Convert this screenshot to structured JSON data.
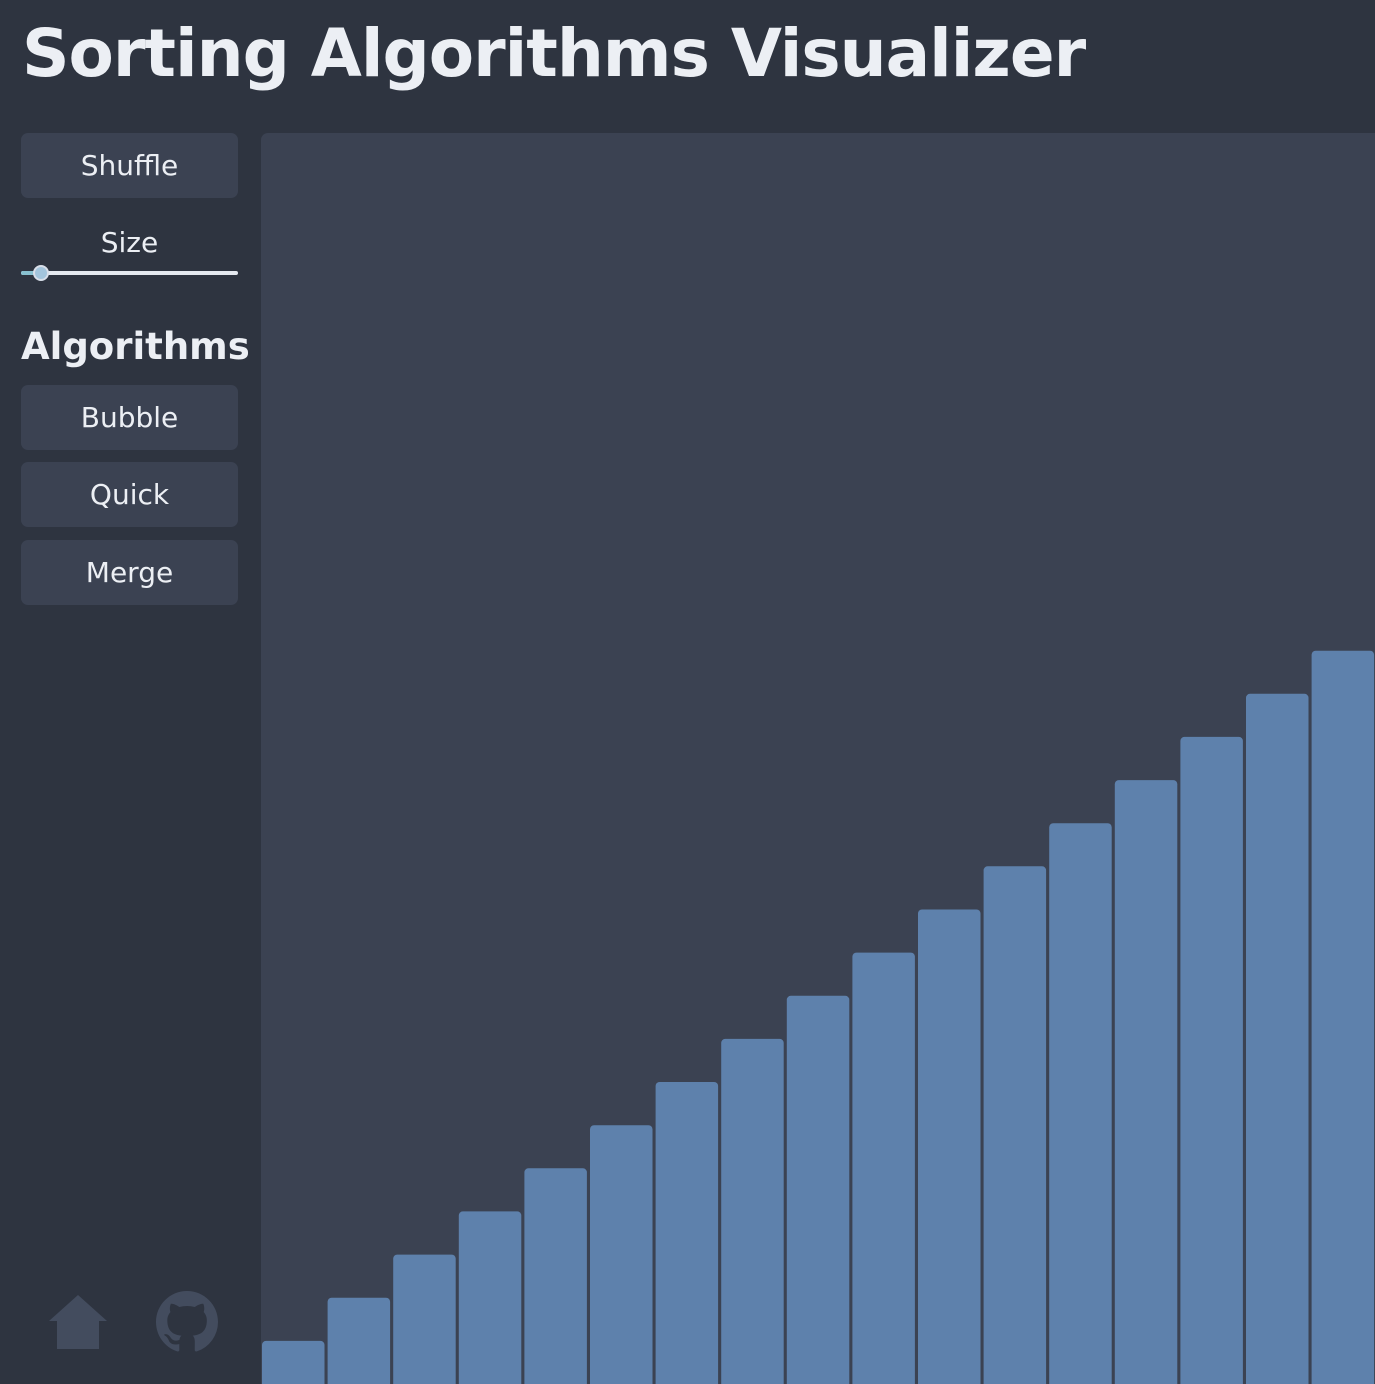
{
  "app": {
    "title": "Sorting Algorithms Visualizer"
  },
  "sidebar": {
    "shuffle_label": "Shuffle",
    "size_label": "Size",
    "size_slider_fraction": 0.09,
    "algorithms_heading": "Algorithms",
    "algorithms": [
      {
        "label": "Bubble"
      },
      {
        "label": "Quick"
      },
      {
        "label": "Merge"
      }
    ],
    "footer_icons": [
      "home-icon",
      "github-icon"
    ]
  },
  "colors": {
    "background": "#2e3440",
    "panel": "#3b4252",
    "bar": "#5e81ac",
    "text": "#eceff4",
    "icon": "#434c5e",
    "slider_accent": "#88c0d0"
  },
  "chart_data": {
    "type": "bar",
    "values": [
      1,
      2,
      3,
      4,
      5,
      6,
      7,
      8,
      9,
      10,
      11,
      12,
      13,
      14,
      15,
      16,
      17
    ],
    "ylim": [
      0,
      29
    ],
    "grid": false
  }
}
